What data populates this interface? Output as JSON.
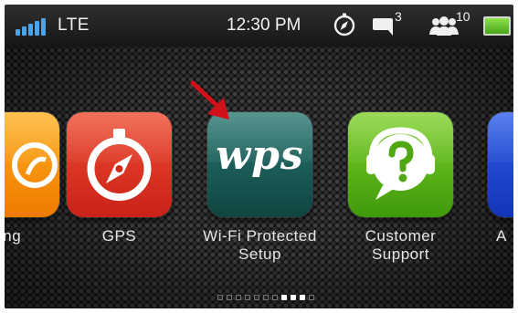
{
  "status_bar": {
    "network": "LTE",
    "time": "12:30 PM",
    "message_count": "3",
    "contacts_count": "10",
    "icons": [
      "signal-bars-icon",
      "compass-icon",
      "message-bubble-icon",
      "group-users-icon",
      "battery-icon"
    ]
  },
  "carousel": {
    "apps": [
      {
        "label": "ing",
        "icon": "partial-app-icon"
      },
      {
        "label": "GPS",
        "icon": "compass-icon"
      },
      {
        "label_line1": "Wi-Fi Protected",
        "label_line2": "Setup",
        "icon_text": "wps"
      },
      {
        "label_line1": "Customer",
        "label_line2": "Support",
        "icon": "headset-question-icon"
      },
      {
        "label": "A",
        "icon": "partial-app-icon"
      }
    ],
    "page_indicator": {
      "total": 11,
      "active": [
        7,
        8,
        9
      ]
    }
  },
  "colors": {
    "accent_arrow": "#d0101a",
    "gps_tile": "#e23a24",
    "wps_tile": "#1c5b56",
    "support_tile": "#5fb81c",
    "status_bar": "#222222"
  }
}
